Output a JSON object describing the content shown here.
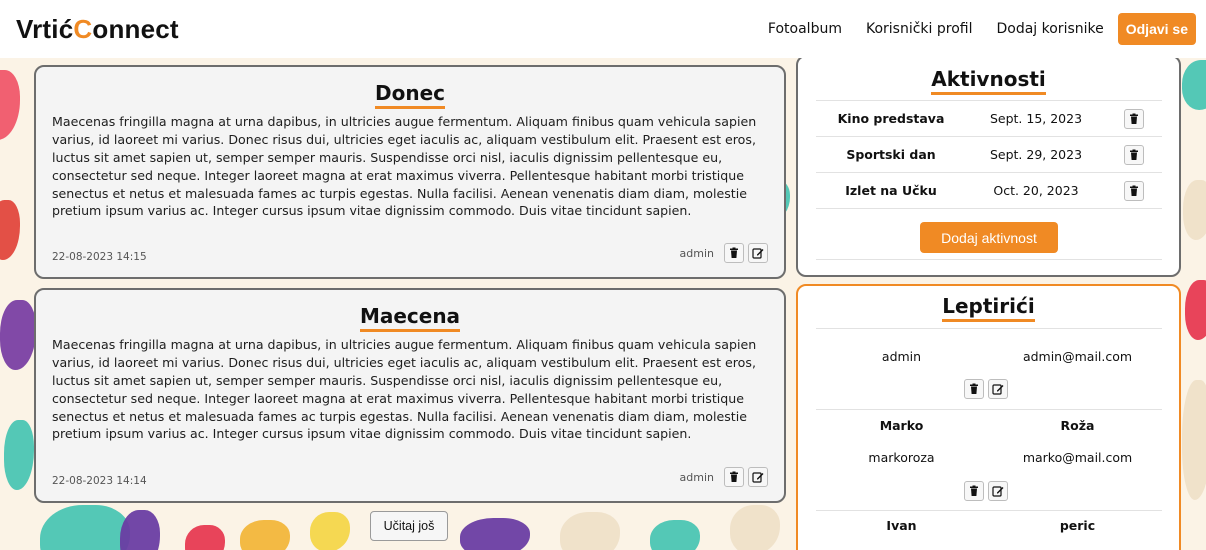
{
  "navbar": {
    "brand_prefix": "Vrtić",
    "brand_c": "C",
    "brand_suffix": "onnect",
    "links": [
      "Fotoalbum",
      "Korisnički profil",
      "Dodaj korisnike"
    ],
    "logout_label": "Odjavi se"
  },
  "posts": [
    {
      "title": "Donec",
      "body": "Maecenas fringilla magna at urna dapibus, in ultricies augue fermentum. Aliquam finibus quam vehicula sapien varius, id laoreet mi varius. Donec risus dui, ultricies eget iaculis ac, aliquam vestibulum elit. Praesent est eros, luctus sit amet sapien ut, semper semper mauris. Suspendisse orci nisl, iaculis dignissim pellentesque eu, consectetur sed neque. Integer laoreet magna at erat maximus viverra. Pellentesque habitant morbi tristique senectus et netus et malesuada fames ac turpis egestas. Nulla facilisi. Aenean venenatis diam diam, molestie pretium ipsum varius ac. Integer cursus ipsum vitae dignissim commodo. Duis vitae tincidunt sapien.",
      "date": "22-08-2023 14:15",
      "author": "admin"
    },
    {
      "title": "Maecena",
      "body": "Maecenas fringilla magna at urna dapibus, in ultricies augue fermentum. Aliquam finibus quam vehicula sapien varius, id laoreet mi varius. Donec risus dui, ultricies eget iaculis ac, aliquam vestibulum elit. Praesent est eros, luctus sit amet sapien ut, semper semper mauris. Suspendisse orci nisl, iaculis dignissim pellentesque eu, consectetur sed neque. Integer laoreet magna at erat maximus viverra. Pellentesque habitant morbi tristique senectus et netus et malesuada fames ac turpis egestas. Nulla facilisi. Aenean venenatis diam diam, molestie pretium ipsum varius ac. Integer cursus ipsum vitae dignissim commodo. Duis vitae tincidunt sapien.",
      "date": "22-08-2023 14:14",
      "author": "admin"
    }
  ],
  "load_more_label": "Učitaj još",
  "activities": {
    "title": "Aktivnosti",
    "items": [
      {
        "name": "Kino predstava",
        "date": "Sept. 15, 2023"
      },
      {
        "name": "Sportski dan",
        "date": "Sept. 29, 2023"
      },
      {
        "name": "Izlet na Učku",
        "date": "Oct. 20, 2023"
      }
    ],
    "add_label": "Dodaj aktivnost"
  },
  "group": {
    "title": "Leptirići",
    "members": [
      {
        "first": "",
        "last": "",
        "username": "admin",
        "email": "admin@mail.com"
      },
      {
        "first": "Marko",
        "last": "Roža",
        "username": "markoroza",
        "email": "marko@mail.com"
      },
      {
        "first": "Ivan",
        "last": "peric",
        "username": "",
        "email": ""
      }
    ]
  },
  "icons": {
    "delete": "trash-icon",
    "edit": "edit-icon"
  },
  "colors": {
    "accent": "#f08a24",
    "card_border": "#6d6d6d",
    "background": "#fbf3e6"
  }
}
